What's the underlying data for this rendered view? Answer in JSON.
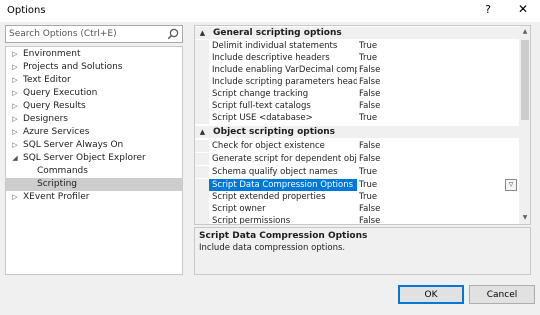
{
  "window": {
    "title": "Options",
    "help_glyph": "?",
    "close_glyph": "✕"
  },
  "search": {
    "placeholder": "Search Options (Ctrl+E)",
    "value": ""
  },
  "tree": {
    "items": [
      {
        "label": "Environment",
        "expander": "▷",
        "selected": false
      },
      {
        "label": "Projects and Solutions",
        "expander": "▷",
        "selected": false
      },
      {
        "label": "Text Editor",
        "expander": "▷",
        "selected": false
      },
      {
        "label": "Query Execution",
        "expander": "▷",
        "selected": false
      },
      {
        "label": "Query Results",
        "expander": "▷",
        "selected": false
      },
      {
        "label": "Designers",
        "expander": "▷",
        "selected": false
      },
      {
        "label": "Azure Services",
        "expander": "▷",
        "selected": false
      },
      {
        "label": "SQL Server Always On",
        "expander": "▷",
        "selected": false
      },
      {
        "label": "SQL Server Object Explorer",
        "expander": "◢",
        "selected": false
      },
      {
        "label": "Commands",
        "expander": "",
        "selected": false
      },
      {
        "label": "Scripting",
        "expander": "",
        "selected": true
      },
      {
        "label": "XEvent Profiler",
        "expander": "▷",
        "selected": false
      }
    ]
  },
  "grid": {
    "categories": [
      {
        "label": "General scripting options",
        "toggle": "▲",
        "rows": [
          {
            "name": "Delimit individual statements",
            "value": "True"
          },
          {
            "name": "Include descriptive headers",
            "value": "True"
          },
          {
            "name": "Include enabling VarDecimal compression",
            "value": "False"
          },
          {
            "name": "Include scripting parameters header",
            "value": "False"
          },
          {
            "name": "Script change tracking",
            "value": "False"
          },
          {
            "name": "Script full-text catalogs",
            "value": "False"
          },
          {
            "name": "Script USE <database>",
            "value": "True"
          }
        ]
      },
      {
        "label": "Object scripting options",
        "toggle": "▲",
        "rows": [
          {
            "name": "Check for object existence",
            "value": "False"
          },
          {
            "name": "Generate script for dependent objects",
            "value": "False"
          },
          {
            "name": "Schema qualify object names",
            "value": "True"
          },
          {
            "name": "Script Data Compression Options",
            "value": "True"
          },
          {
            "name": "Script extended properties",
            "value": "True"
          },
          {
            "name": "Script owner",
            "value": "False"
          },
          {
            "name": "Script permissions",
            "value": "False"
          }
        ]
      }
    ],
    "selected_row": "Script Data Compression Options",
    "dropdown_glyph": "▽",
    "scroll_up_glyph": "▲",
    "scroll_down_glyph": "▼"
  },
  "description": {
    "title": "Script Data Compression Options",
    "text": "Include data compression options."
  },
  "buttons": {
    "ok": "OK",
    "cancel": "Cancel"
  },
  "colors": {
    "selection_blue": "#0078d7",
    "tree_selection": "#cdcdcd",
    "dialog_background": "#f0f0f0"
  }
}
